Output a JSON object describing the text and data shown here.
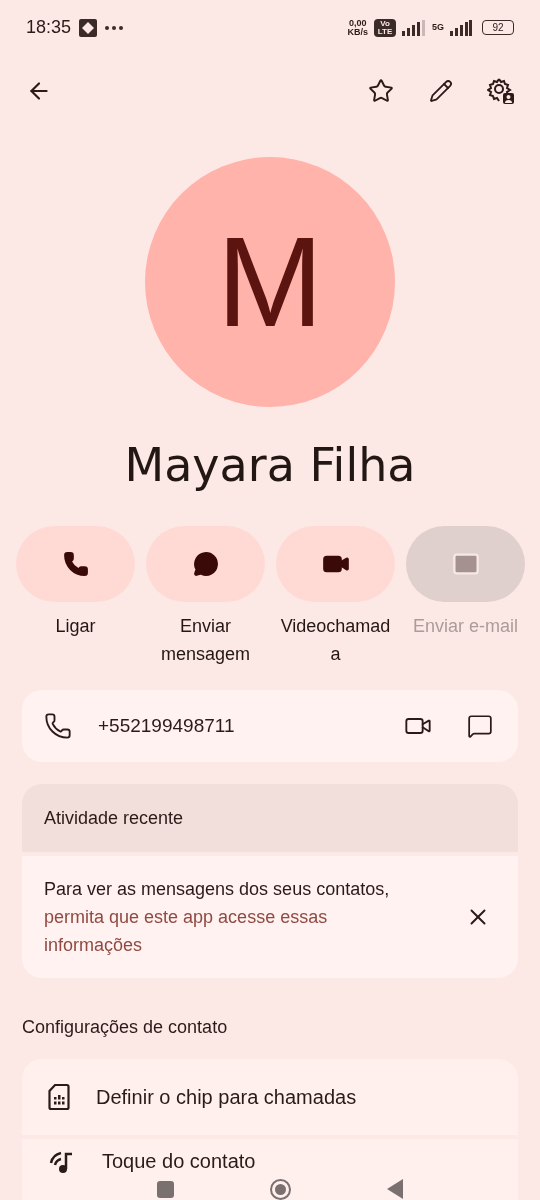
{
  "status_bar": {
    "time": "18:35",
    "speed": "0,00",
    "speed_unit": "KB/s",
    "volte": "Vo LTE",
    "network": "5G",
    "battery": "92"
  },
  "contact": {
    "initial": "M",
    "name": "Mayara Filha",
    "starred": false
  },
  "actions": [
    {
      "kind": "call",
      "label": "Ligar",
      "disabled": false
    },
    {
      "kind": "message",
      "label": "Enviar mensagem",
      "disabled": false
    },
    {
      "kind": "video",
      "label": "Videochamada",
      "disabled": false
    },
    {
      "kind": "email",
      "label": "Enviar e-mail",
      "disabled": true
    }
  ],
  "phone": {
    "number": "+552199498711"
  },
  "recent_activity": {
    "title": "Atividade recente",
    "text": "Para ver as mensagens dos seus contatos,",
    "link": "permita que este app acesse essas informações"
  },
  "settings": {
    "title": "Configurações de contato",
    "items": [
      {
        "kind": "sim",
        "label": "Definir o chip para chamadas"
      },
      {
        "kind": "ringtone",
        "label": "Toque do contato"
      }
    ]
  }
}
